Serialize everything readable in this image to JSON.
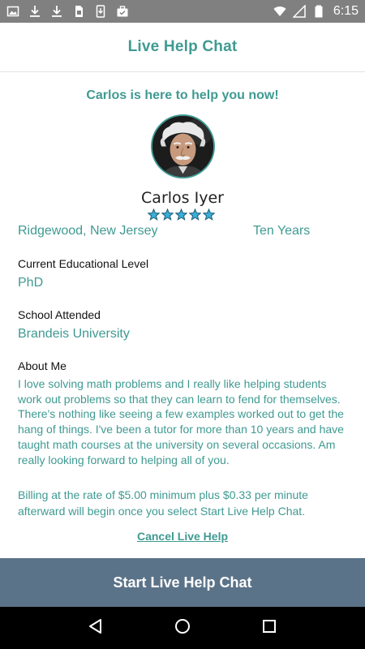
{
  "status_bar": {
    "time": "6:15",
    "left_icons": [
      "image-icon",
      "download-icon",
      "download-icon",
      "sim-card-icon",
      "phone-download-icon",
      "briefcase-icon"
    ],
    "right_icons": [
      "wifi-icon",
      "signal-icon",
      "battery-icon"
    ]
  },
  "app_bar": {
    "title": "Live Help Chat"
  },
  "tutor": {
    "banner": "Carlos is here to help you now!",
    "name": "Carlos Iyer",
    "rating_stars": 5,
    "location": "Ridgewood, New Jersey",
    "experience": "Ten Years",
    "education_label": "Current Educational Level",
    "education_value": "PhD",
    "school_label": "School Attended",
    "school_value": "Brandeis University",
    "about_label": "About Me",
    "about_text": "I love solving math problems and I really like helping students work out problems so that they can learn to fend for themselves. There's nothing like seeing a few examples worked out to get the hang of things. I've been a tutor for more than 10 years and have taught math courses at the university on several occasions. Am really looking forward to helping all of you."
  },
  "billing": {
    "text": "Billing at the rate of $5.00 minimum plus $0.33 per minute afterward will begin once you select Start Live Help Chat."
  },
  "actions": {
    "cancel_label": "Cancel Live Help",
    "start_label": "Start Live Help Chat"
  },
  "nav_bar": {
    "icons": [
      "back-icon",
      "home-icon",
      "recents-icon"
    ]
  },
  "colors": {
    "accent": "#3f9a92",
    "status_bar": "#808080",
    "primary_button": "#5b7389",
    "star_fill": "#3aaed8",
    "star_stroke": "#1d5c76"
  }
}
